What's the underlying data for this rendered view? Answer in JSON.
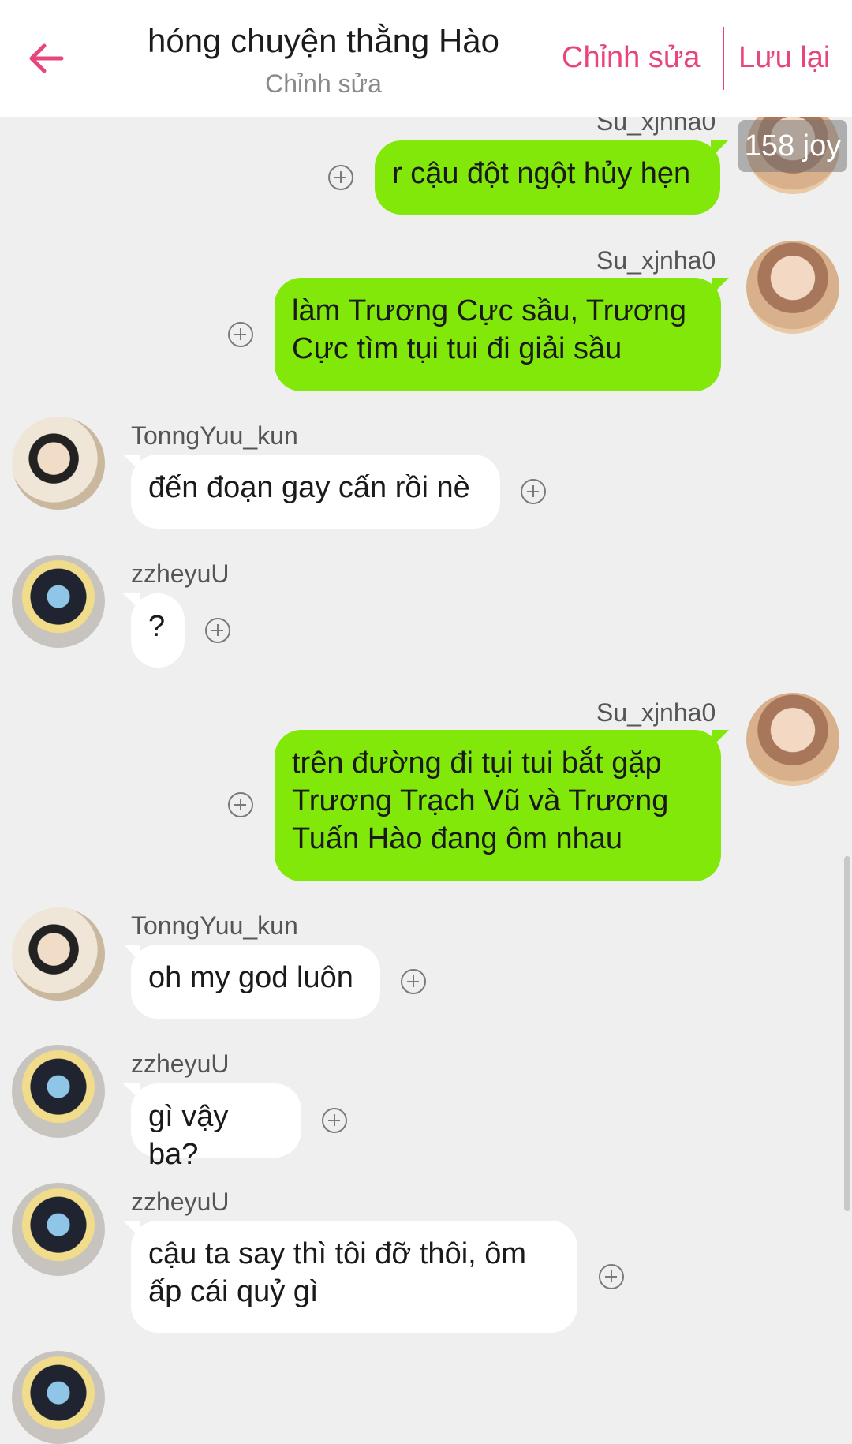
{
  "header": {
    "title": "hóng chuyện thằng Hào",
    "subtitle": "Chỉnh sửa",
    "edit_label": "Chỉnh sửa",
    "save_label": "Lưu lại"
  },
  "badge": "158 joy",
  "messages": [
    {
      "sender": "Su_xjnha0",
      "side": "right",
      "text_lines": [
        "r cậu đột ngột hủy hẹn"
      ]
    },
    {
      "sender": "Su_xjnha0",
      "side": "right",
      "text_lines": [
        "làm Trương Cực sầu, Trương",
        "Cực tìm tụi tui đi giải sầu"
      ]
    },
    {
      "sender": "TonngYuu_kun",
      "side": "left",
      "text_lines": [
        "đến đoạn gay cấn rồi nè"
      ]
    },
    {
      "sender": "zzheyuU",
      "side": "left",
      "text_lines": [
        "?"
      ]
    },
    {
      "sender": "Su_xjnha0",
      "side": "right",
      "text_lines": [
        "trên đường đi tụi tui bắt gặp",
        "Trương Trạch Vũ và Trương",
        "Tuấn Hào đang ôm nhau"
      ]
    },
    {
      "sender": "TonngYuu_kun",
      "side": "left",
      "text_lines": [
        "oh my god luôn"
      ]
    },
    {
      "sender": "zzheyuU",
      "side": "left",
      "text_lines": [
        "gì vậy ba?"
      ]
    },
    {
      "sender": "zzheyuU",
      "side": "left",
      "text_lines": [
        "cậu ta say thì tôi đỡ thôi, ôm",
        "ấp cái quỷ gì"
      ]
    }
  ],
  "colors": {
    "accent": "#e8457c",
    "my_bubble": "#82e80a",
    "their_bubble": "#ffffff",
    "background": "#efefef"
  }
}
